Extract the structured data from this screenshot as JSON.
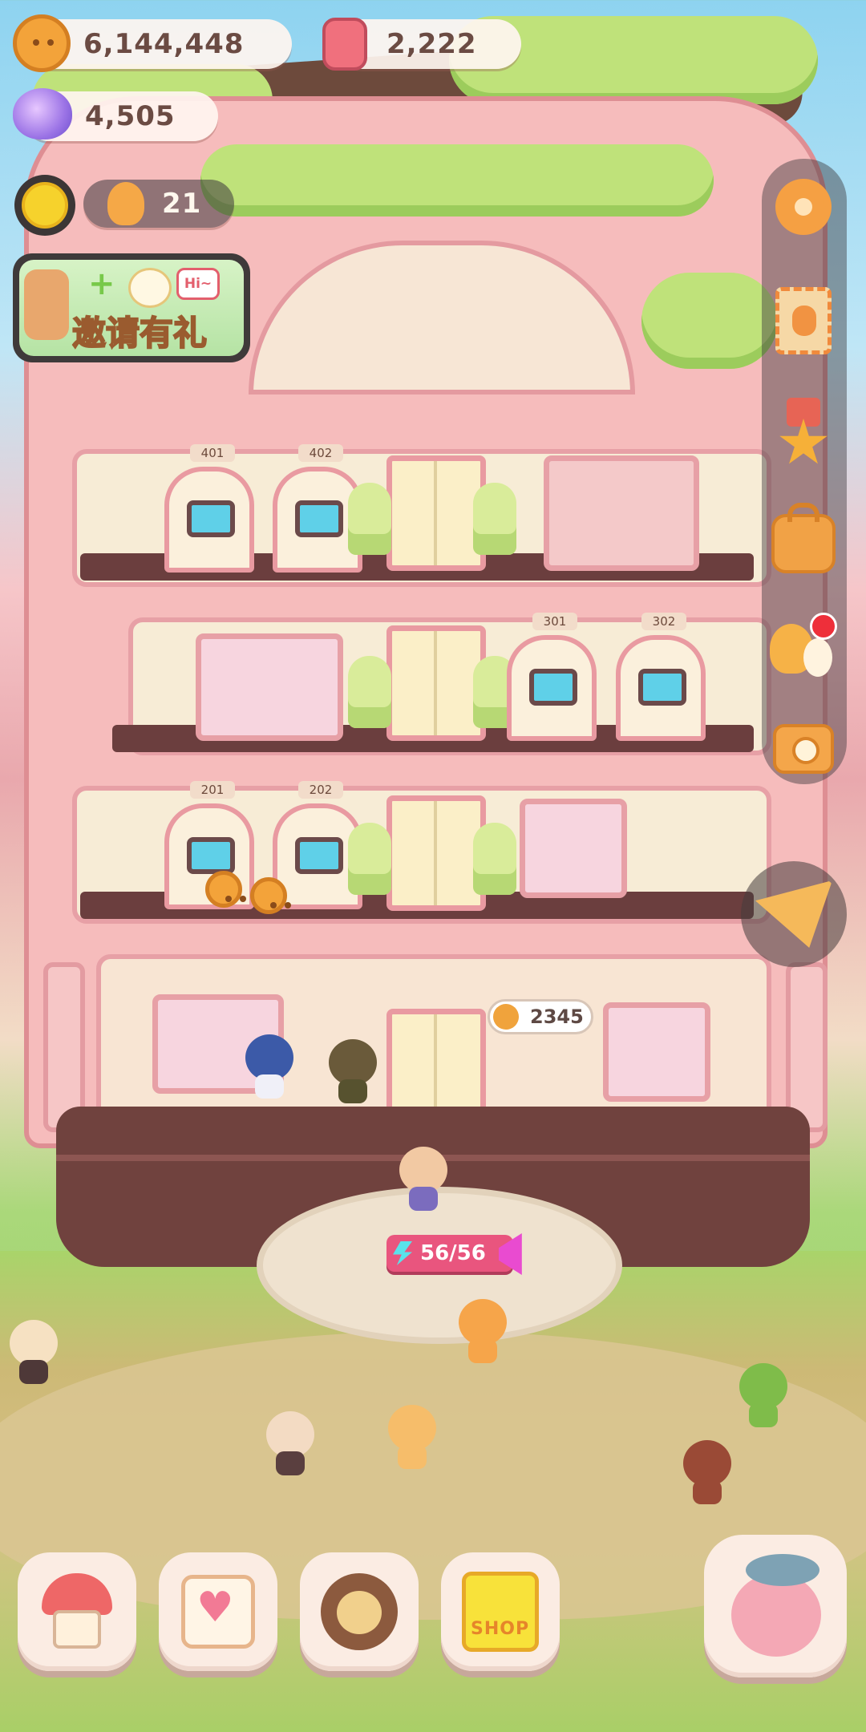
{
  "hud": {
    "coins": "6,144,448",
    "tickets": "2,222",
    "gems": "4,505",
    "population": "21"
  },
  "invite_banner": {
    "label": "邀请有礼",
    "hi_badge": "Hi~"
  },
  "rooms": {
    "floor4": [
      "401",
      "402"
    ],
    "floor3": [
      "301",
      "302"
    ],
    "floor2": [
      "201",
      "202"
    ]
  },
  "price_tag": "2345",
  "stamina": "56/56",
  "dock": {
    "shop_sign": "SHOP"
  },
  "side_menu": {
    "has_notification": true,
    "icons": [
      "gear-icon",
      "stamp-icon",
      "medal-icon",
      "bag-icon",
      "friends-icon",
      "camera-icon"
    ]
  },
  "colors": {
    "accent": "#e9557e",
    "coin": "#f3a33a",
    "notification": "#ee2f3a"
  }
}
